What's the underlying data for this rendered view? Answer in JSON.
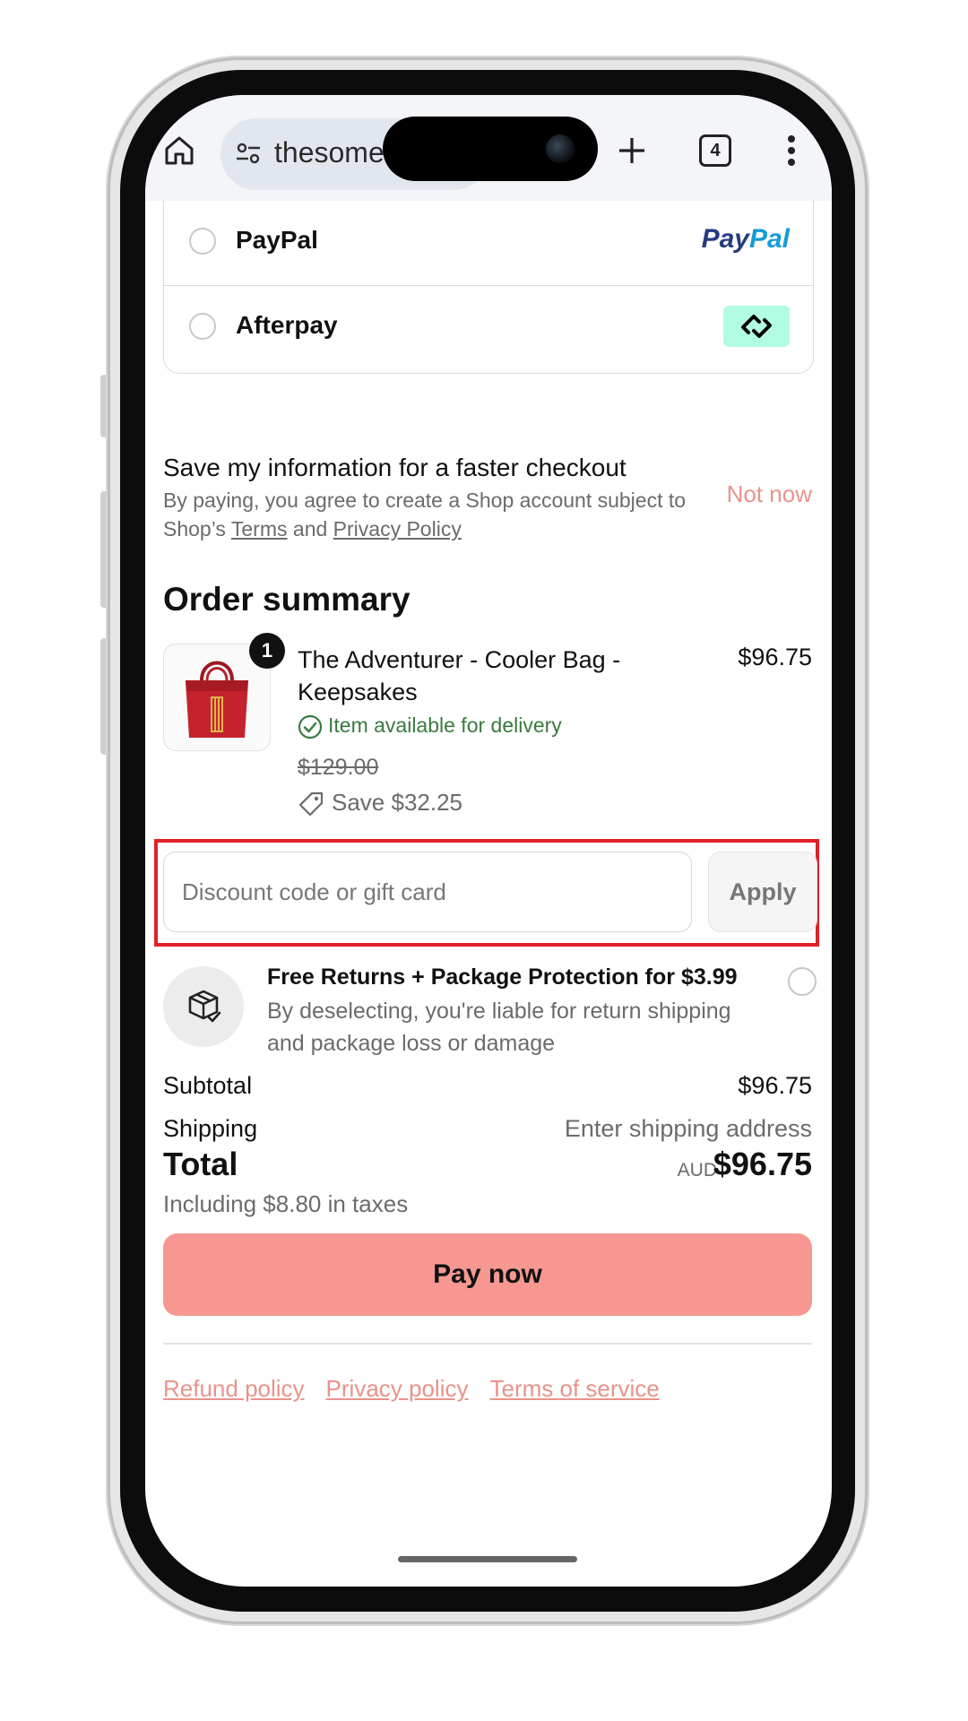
{
  "browser": {
    "url_text": "thesome",
    "tab_count": "4"
  },
  "payment_methods": [
    {
      "label": "PayPal",
      "logo_text_a": "Pay",
      "logo_text_b": "Pal"
    },
    {
      "label": "Afterpay",
      "logo_icon": "afterpay-icon"
    }
  ],
  "save_info": {
    "title": "Save my information for a faster checkout",
    "desc_prefix": "By paying, you agree to create a Shop account subject to Shop’s ",
    "terms_link": "Terms",
    "and_text": " and ",
    "privacy_link": "Privacy Policy",
    "not_now": "Not now"
  },
  "order_summary": {
    "title": "Order summary",
    "item": {
      "quantity": "1",
      "name": "The Adventurer - Cooler Bag - Keepsakes",
      "price": "$96.75",
      "availability": "Item available for delivery",
      "original_price": "$129.00",
      "savings": "Save $32.25"
    }
  },
  "discount": {
    "placeholder": "Discount code or gift card",
    "apply_label": "Apply"
  },
  "protection": {
    "title": "Free Returns + Package Protection for $3.99",
    "desc": "By deselecting, you're liable for return shipping and package loss or damage"
  },
  "totals": {
    "subtotal_label": "Subtotal",
    "subtotal_value": "$96.75",
    "shipping_label": "Shipping",
    "shipping_value": "Enter shipping address",
    "total_label": "Total",
    "currency": "AUD",
    "total_value": "$96.75",
    "tax_note": "Including $8.80 in taxes"
  },
  "pay_now_label": "Pay now",
  "footer": {
    "refund": "Refund policy",
    "privacy": "Privacy policy",
    "terms": "Terms of service"
  },
  "colors": {
    "accent": "#f69891",
    "link": "#e9938a",
    "highlight": "#e0202a",
    "success": "#3a7a3f"
  }
}
